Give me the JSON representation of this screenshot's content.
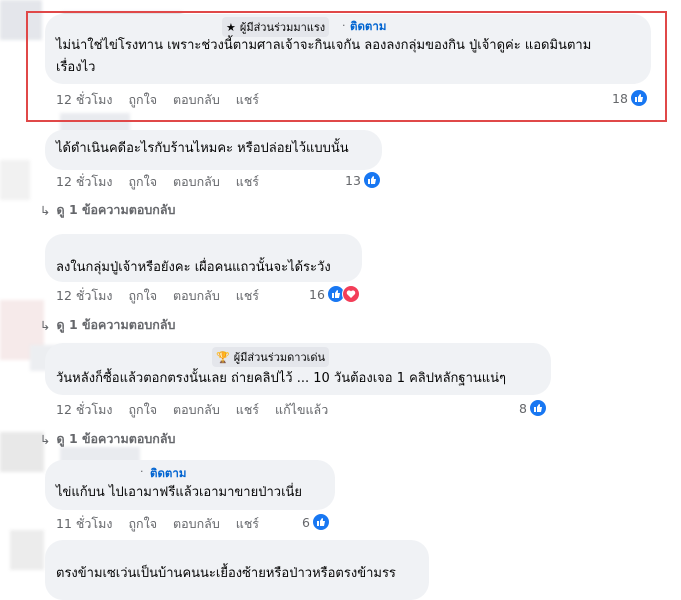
{
  "comments": [
    {
      "badge": "ผู้มีส่วนร่วมมาแรง",
      "follow": "ติดตาม",
      "lines": [
        "ไม่น่าใช่ไข่โรงทาน เพราะช่วงนี้ตามศาลเจ้าจะกินเจกัน ลองลงกลุ่มของกิน ปู่เจ้าดูค่ะ แอดมินตาม",
        "เรื่องไว"
      ],
      "time": "12 ชั่วโมง",
      "like": "ถูกใจ",
      "reply": "ตอบกลับ",
      "share": "แชร์",
      "reactions": "18"
    },
    {
      "lines": [
        "ได้ดำเนินคดีอะไรกับร้านไหมคะ หรือปล่อยไว้แบบนั้น"
      ],
      "time": "12 ชั่วโมง",
      "like": "ถูกใจ",
      "reply": "ตอบกลับ",
      "share": "แชร์",
      "reactions": "13",
      "view_replies": "ดู 1 ข้อความตอบกลับ"
    },
    {
      "lines": [
        "ลงในกลุ่มปู่เจ้าหรือยังคะ เผื่อคนแถวนั้นจะได้ระวัง"
      ],
      "time": "12 ชั่วโมง",
      "like": "ถูกใจ",
      "reply": "ตอบกลับ",
      "share": "แชร์",
      "reactions": "16",
      "view_replies": "ดู 1 ข้อความตอบกลับ"
    },
    {
      "badge": "ผู้มีส่วนร่วมดาวเด่น",
      "lines": [
        "วันหลังก็ซื้อแล้วตอกตรงนั้นเลย ถ่ายคลิปไว้ ... 10 วันต้องเจอ 1 คลิปหลักฐานแน่ๆ"
      ],
      "time": "12 ชั่วโมง",
      "like": "ถูกใจ",
      "reply": "ตอบกลับ",
      "share": "แชร์",
      "edited": "แก้ไขแล้ว",
      "reactions": "8",
      "view_replies": "ดู 1 ข้อความตอบกลับ"
    },
    {
      "follow": "ติดตาม",
      "lines": [
        "ไข่แก้บน ไปเอามาฟรีแล้วเอามาขายป่าวเนี่ย"
      ],
      "time": "11 ชั่วโมง",
      "like": "ถูกใจ",
      "reply": "ตอบกลับ",
      "share": "แชร์",
      "reactions": "6"
    },
    {
      "lines": [
        "ตรงข้ามเซเว่นเป็นบ้านคนนะเยื้องซ้ายหรือป่าวหรือตรงข้ามรร"
      ]
    }
  ],
  "colors": {
    "highlight": "#e04848",
    "like": "#1877f2",
    "love": "#f33e58",
    "bubble": "#f0f2f5"
  },
  "icons": {
    "badge1": "star-icon",
    "badge2": "trophy-icon",
    "reply_arrow": "reply-arrow-icon"
  }
}
